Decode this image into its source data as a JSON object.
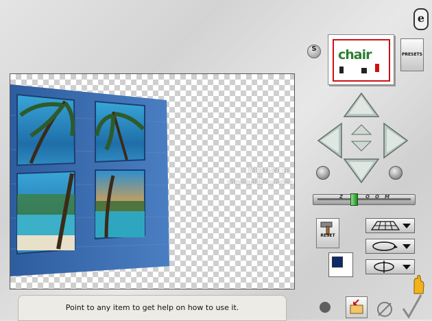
{
  "app": {
    "logo_glyph": "e"
  },
  "toolbar": {
    "s_label": "S",
    "presets_label": "PRESETS"
  },
  "preview": {
    "word": "chair"
  },
  "canvas": {
    "watermark_main": "Pinuccia",
    "watermark_sub": "www.malditregrafica.eu"
  },
  "zoom": {
    "labels": [
      "Z",
      "O",
      "O",
      "M"
    ],
    "level": 0.38
  },
  "tools": {
    "reset_label": "RESET"
  },
  "status": {
    "help_text": "Point to any item to get help on how to use it."
  },
  "colors": {
    "accent_green": "#2b7f32",
    "border_red": "#cc1111",
    "swatch": "#0f2a6b"
  }
}
